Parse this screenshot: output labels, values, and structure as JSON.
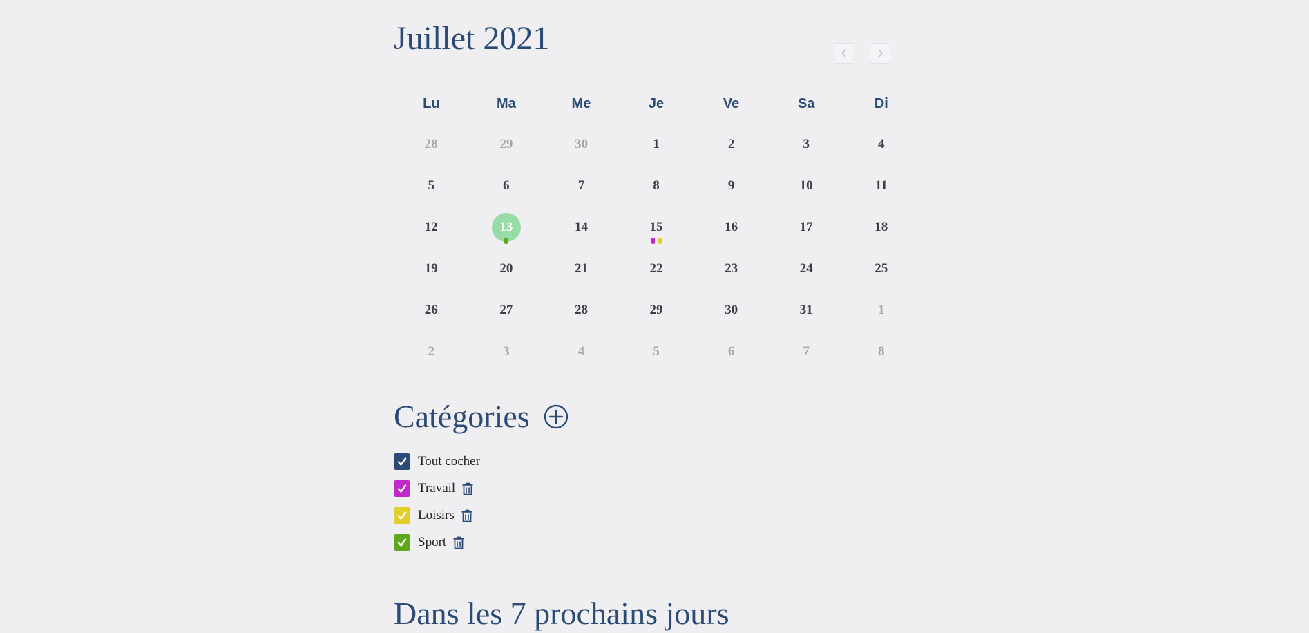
{
  "calendar": {
    "title": "Juillet 2021",
    "weekdays": [
      "Lu",
      "Ma",
      "Me",
      "Je",
      "Ve",
      "Sa",
      "Di"
    ],
    "weeks": [
      [
        {
          "d": "28",
          "muted": true
        },
        {
          "d": "29",
          "muted": true
        },
        {
          "d": "30",
          "muted": true
        },
        {
          "d": "1"
        },
        {
          "d": "2"
        },
        {
          "d": "3"
        },
        {
          "d": "4"
        }
      ],
      [
        {
          "d": "5"
        },
        {
          "d": "6"
        },
        {
          "d": "7"
        },
        {
          "d": "8"
        },
        {
          "d": "9"
        },
        {
          "d": "10"
        },
        {
          "d": "11"
        }
      ],
      [
        {
          "d": "12"
        },
        {
          "d": "13",
          "today": true,
          "dots": [
            "#5fa81e"
          ]
        },
        {
          "d": "14"
        },
        {
          "d": "15",
          "dots": [
            "#c12ac9",
            "#e2cf2e"
          ]
        },
        {
          "d": "16"
        },
        {
          "d": "17"
        },
        {
          "d": "18"
        }
      ],
      [
        {
          "d": "19"
        },
        {
          "d": "20"
        },
        {
          "d": "21"
        },
        {
          "d": "22"
        },
        {
          "d": "23"
        },
        {
          "d": "24"
        },
        {
          "d": "25"
        }
      ],
      [
        {
          "d": "26"
        },
        {
          "d": "27"
        },
        {
          "d": "28"
        },
        {
          "d": "29"
        },
        {
          "d": "30"
        },
        {
          "d": "31"
        },
        {
          "d": "1",
          "muted": true
        }
      ],
      [
        {
          "d": "2",
          "muted": true
        },
        {
          "d": "3",
          "muted": true
        },
        {
          "d": "4",
          "muted": true
        },
        {
          "d": "5",
          "muted": true
        },
        {
          "d": "6",
          "muted": true
        },
        {
          "d": "7",
          "muted": true
        },
        {
          "d": "8",
          "muted": true
        }
      ]
    ],
    "prev_icon": "chevron-left-icon",
    "next_icon": "chevron-right-icon"
  },
  "categories": {
    "title": "Catégories",
    "add_icon": "plus-circle-icon",
    "check_all": {
      "label": "Tout cocher",
      "color": "#2b4a75",
      "checked": true
    },
    "items": [
      {
        "label": "Travail",
        "color": "#c12ac9",
        "checked": true,
        "icon": "trash-icon"
      },
      {
        "label": "Loisirs",
        "color": "#e2cf2e",
        "checked": true,
        "icon": "trash-icon"
      },
      {
        "label": "Sport",
        "color": "#5fa81e",
        "checked": true,
        "icon": "trash-icon"
      }
    ]
  },
  "next_section": {
    "title": "Dans les 7 prochains jours"
  },
  "colors": {
    "accent": "#2b4a75",
    "today_bg": "#97dba6",
    "background": "#efeff2"
  }
}
